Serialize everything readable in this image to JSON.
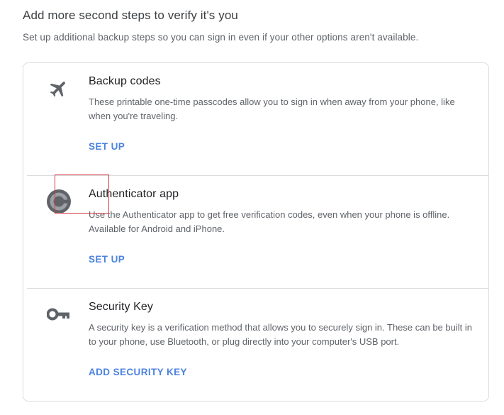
{
  "header": {
    "title": "Add more second steps to verify it's you",
    "subtitle": "Set up additional backup steps so you can sign in even if your other options aren't available."
  },
  "options": [
    {
      "icon": "airplane-icon",
      "title": "Backup codes",
      "description": "These printable one-time passcodes allow you to sign in when away from your phone, like when you're traveling.",
      "action": "SET UP"
    },
    {
      "icon": "authenticator-icon",
      "title": "Authenticator app",
      "description": "Use the Authenticator app to get free verification codes, even when your phone is offline. Available for Android and iPhone.",
      "action": "SET UP"
    },
    {
      "icon": "key-icon",
      "title": "Security Key",
      "description": "A security key is a verification method that allows you to securely sign in. These can be built in to your phone, use Bluetooth, or plug directly into your computer's USB port.",
      "action": "ADD SECURITY KEY"
    }
  ],
  "colors": {
    "accent": "#4c82e0",
    "highlight": "#d9363e",
    "icon": "#5f6368"
  }
}
